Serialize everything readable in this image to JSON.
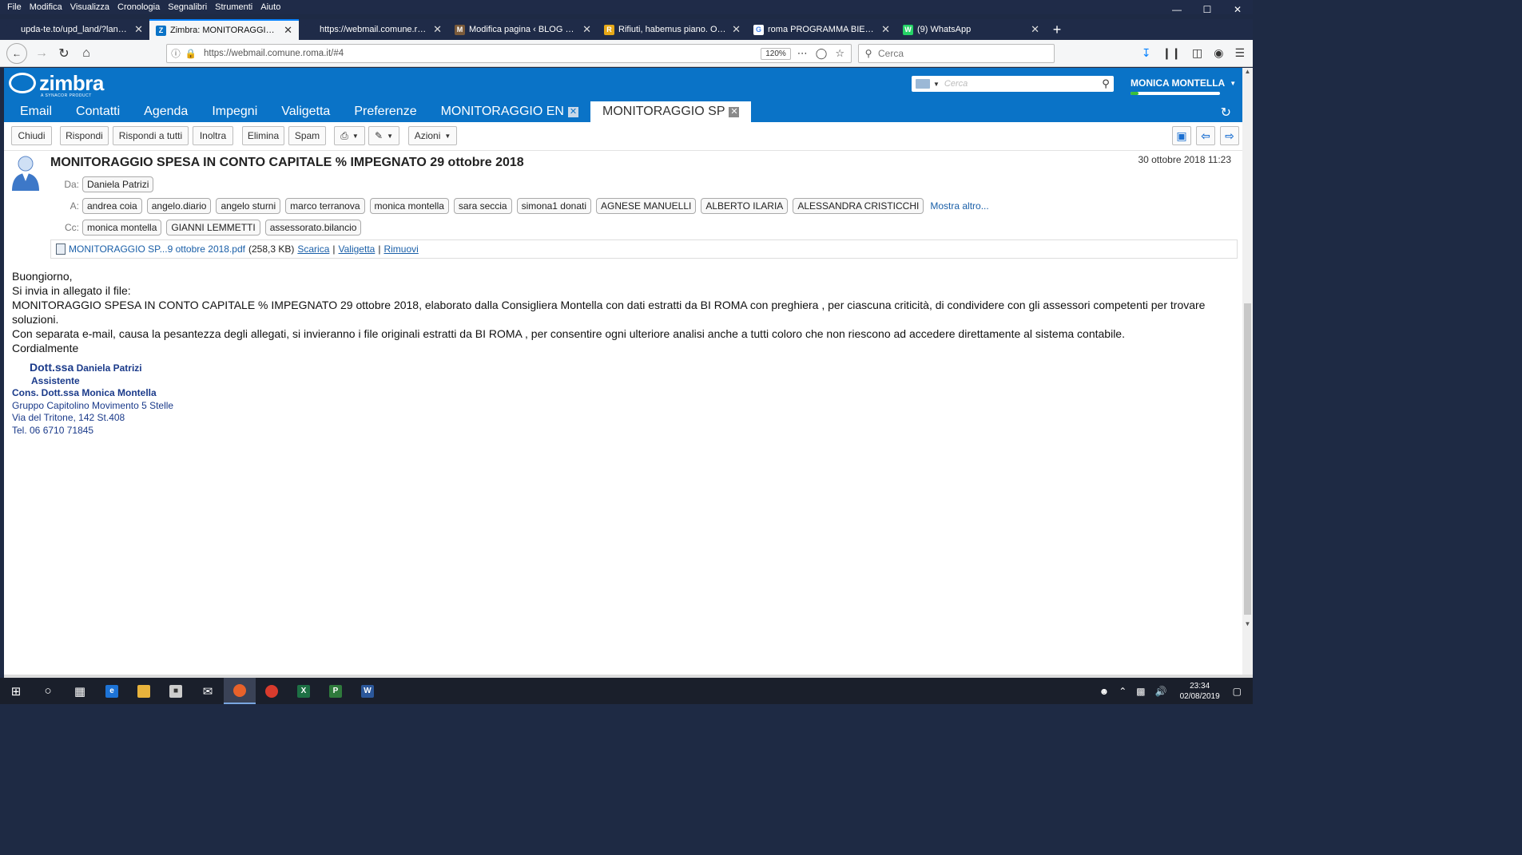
{
  "browser": {
    "menu": [
      "File",
      "Modifica",
      "Visualizza",
      "Cronologia",
      "Segnalibri",
      "Strumenti",
      "Aiuto"
    ],
    "window_controls": [
      "—",
      "☐",
      "✕"
    ],
    "tabs": [
      {
        "label": "upda-te.to/upd_land/?lang=it&sho",
        "favicon": "",
        "favicon_color": "#1f2b48",
        "active": false
      },
      {
        "label": "Zimbra: MONITORAGGIO SPES",
        "favicon": "Z",
        "favicon_color": "#0a73c7",
        "active": true
      },
      {
        "label": "https://webmail.comune.roma.it/s",
        "favicon": "",
        "favicon_color": "#1f2b48",
        "active": false
      },
      {
        "label": "Modifica pagina ‹ BLOG di Mo",
        "favicon": "M",
        "favicon_color": "#7a5a3a",
        "active": false
      },
      {
        "label": "Rifiuti, habemus piano. Ok dal",
        "favicon": "R",
        "favicon_color": "#e6a817",
        "active": false
      },
      {
        "label": "roma PROGRAMMA BIENNALE",
        "favicon": "G",
        "favicon_color": "#ffffff",
        "active": false
      },
      {
        "label": "(9) WhatsApp",
        "favicon": "W",
        "favicon_color": "#25d366",
        "active": false
      }
    ],
    "url": "https://webmail.comune.roma.it/#4",
    "zoom": "120%",
    "search_placeholder": "Cerca"
  },
  "zimbra": {
    "logo_text": "zimbra",
    "logo_sub": "A SYNACOR PRODUCT",
    "search_placeholder": "Cerca",
    "user_name": "MONICA MONTELLA",
    "quota_fraction": 0.09,
    "app_tabs": [
      {
        "label": "Email",
        "closable": false,
        "active": false
      },
      {
        "label": "Contatti",
        "closable": false,
        "active": false
      },
      {
        "label": "Agenda",
        "closable": false,
        "active": false
      },
      {
        "label": "Impegni",
        "closable": false,
        "active": false
      },
      {
        "label": "Valigetta",
        "closable": false,
        "active": false
      },
      {
        "label": "Preferenze",
        "closable": false,
        "active": false
      },
      {
        "label": "MONITORAGGIO EN",
        "closable": true,
        "active": false
      },
      {
        "label": "MONITORAGGIO SP",
        "closable": true,
        "active": true
      }
    ],
    "toolbar": {
      "close": "Chiudi",
      "reply": "Rispondi",
      "reply_all": "Rispondi a tutti",
      "forward": "Inoltra",
      "delete": "Elimina",
      "spam": "Spam",
      "actions": "Azioni"
    }
  },
  "message": {
    "subject": "MONITORAGGIO SPESA IN CONTO CAPITALE % IMPEGNATO 29 ottobre 2018",
    "date": "30 ottobre 2018 11:23",
    "from_label": "Da:",
    "from": "Daniela Patrizi",
    "to_label": "A:",
    "to": [
      "andrea coia",
      "angelo.diario",
      "angelo sturni",
      "marco terranova",
      "monica montella",
      "sara seccia",
      "simona1 donati",
      "AGNESE MANUELLI",
      "ALBERTO ILARIA",
      "ALESSANDRA CRISTICCHI"
    ],
    "show_more": "Mostra altro...",
    "cc_label": "Cc:",
    "cc": [
      "monica montella",
      "GIANNI LEMMETTI",
      "assessorato.bilancio"
    ],
    "attachment": {
      "name": "MONITORAGGIO SP...9 ottobre 2018.pdf",
      "size": "(258,3 KB)",
      "download": "Scarica",
      "briefcase": "Valigetta",
      "remove": "Rimuovi"
    },
    "body": [
      "Buongiorno,",
      "Si invia in allegato il file:",
      "MONITORAGGIO SPESA IN CONTO CAPITALE % IMPEGNATO 29 ottobre 2018, elaborato dalla Consigliera Montella con dati estratti da BI ROMA  con preghiera , per ciascuna criticità, di condividere con gli assessori competenti per trovare soluzioni.",
      "Con separata e-mail, causa la pesantezza degli allegati,  si invieranno i file originali estratti da BI ROMA , per consentire ogni ulteriore analisi anche a tutti coloro che non riescono ad accedere direttamente al sistema contabile.",
      "Cordialmente"
    ],
    "signature": {
      "title_prefix": "Dott.ssa",
      "name": "Daniela Patrizi",
      "role": "Assistente",
      "line1": "Cons. Dott.ssa Monica Montella",
      "line2": "Gruppo Capitolino Movimento 5 Stelle",
      "line3": "Via del Tritone, 142 St.408",
      "line4": "Tel. 06 6710 71845"
    }
  },
  "taskbar": {
    "time": "23:34",
    "date": "02/08/2019"
  }
}
